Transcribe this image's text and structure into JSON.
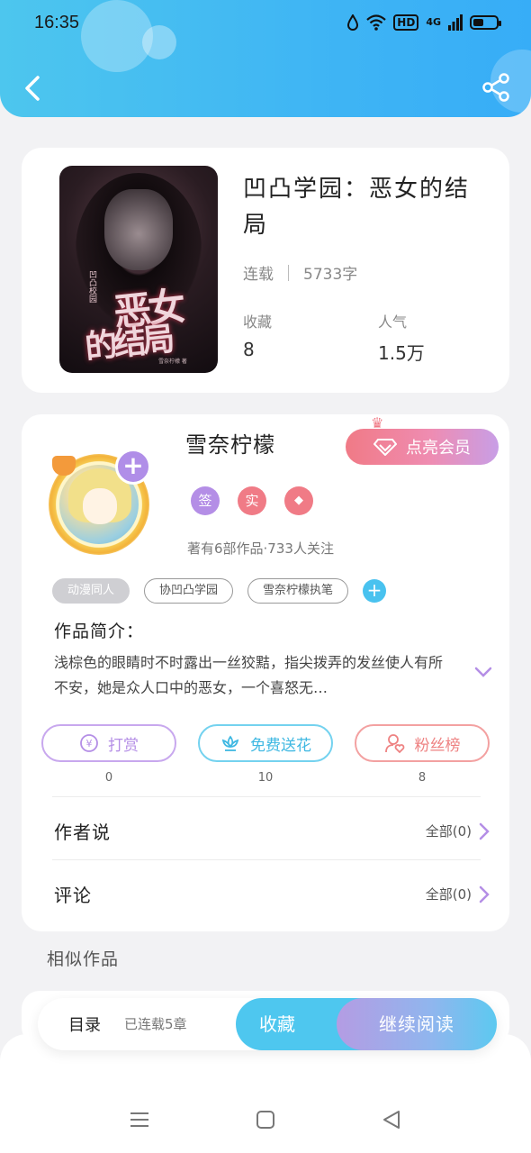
{
  "status_bar": {
    "time": "16:35",
    "hd": "HD",
    "net": "4G",
    "battery_level": 0.45
  },
  "header": {
    "back_icon": "chevron-left-icon",
    "share_icon": "share-icon"
  },
  "book": {
    "title": "凹凸学园：恶女的结局",
    "status": "连载",
    "word_count": "5733字",
    "favorites_label": "收藏",
    "favorites_value": "8",
    "popularity_label": "人气",
    "popularity_value": "1.5万",
    "cover": {
      "line1": "恶女",
      "line2": "的结局",
      "series": "凹凸校园",
      "author": "雪奈柠檬 著"
    }
  },
  "author": {
    "name": "雪奈柠檬",
    "vip_label": "点亮会员",
    "badges": [
      {
        "label": "签",
        "color": "#b48ee6"
      },
      {
        "label": "实",
        "color": "#f07b86"
      },
      {
        "label": "◆",
        "color": "#f07b86"
      }
    ],
    "meta": "著有6部作品·733人关注",
    "tags": [
      "动漫同人",
      "协凹凸学园",
      "雪奈柠檬执笔"
    ],
    "intro_label": "作品简介：",
    "intro_text": "浅棕色的眼睛时不时露出一丝狡黠，指尖拨弄的发丝使人有所不安，她是众人口中的恶女，一个喜怒无…",
    "actions": [
      {
        "label": "打赏",
        "icon": "yen-coin-icon",
        "count": "0",
        "color": "#b48ee6"
      },
      {
        "label": "免费送花",
        "icon": "flower-icon",
        "count": "10",
        "color": "#4ec3e8"
      },
      {
        "label": "粉丝榜",
        "icon": "fans-icon",
        "count": "8",
        "color": "#f08a8a"
      }
    ],
    "author_says_label": "作者说",
    "author_says_link": "全部(0)",
    "comments_label": "评论",
    "comments_link": "全部(0)"
  },
  "similar_label": "相似作品",
  "bottom_bar": {
    "toc_label": "目录",
    "toc_count": "已连载5章",
    "favorite_label": "收藏",
    "read_label": "继续阅读"
  }
}
